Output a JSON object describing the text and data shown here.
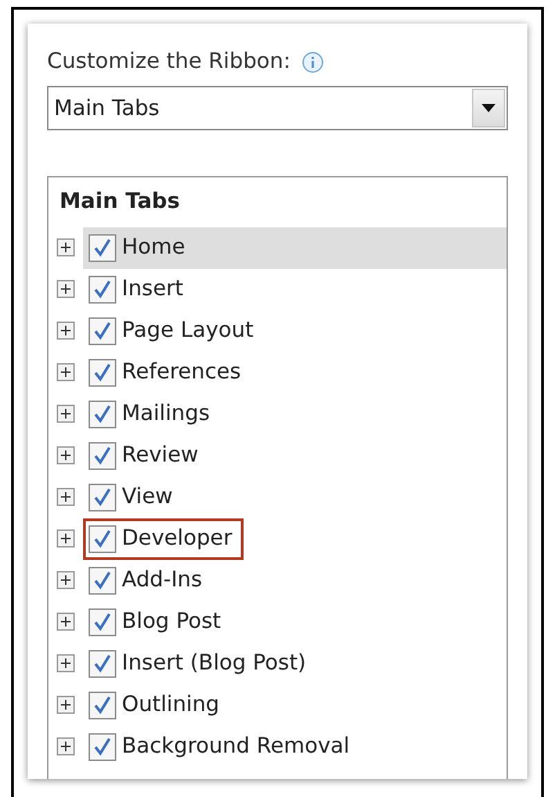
{
  "label": "Customize the Ribbon:",
  "dropdown": {
    "value": "Main Tabs"
  },
  "tree": {
    "header": "Main Tabs",
    "items": [
      {
        "label": "Home",
        "expanded": false,
        "checked": true,
        "selected": true,
        "outlined": false
      },
      {
        "label": "Insert",
        "expanded": false,
        "checked": true,
        "selected": false,
        "outlined": false
      },
      {
        "label": "Page Layout",
        "expanded": false,
        "checked": true,
        "selected": false,
        "outlined": false
      },
      {
        "label": "References",
        "expanded": false,
        "checked": true,
        "selected": false,
        "outlined": false
      },
      {
        "label": "Mailings",
        "expanded": false,
        "checked": true,
        "selected": false,
        "outlined": false
      },
      {
        "label": "Review",
        "expanded": false,
        "checked": true,
        "selected": false,
        "outlined": false
      },
      {
        "label": "View",
        "expanded": false,
        "checked": true,
        "selected": false,
        "outlined": false
      },
      {
        "label": "Developer",
        "expanded": false,
        "checked": true,
        "selected": false,
        "outlined": true
      },
      {
        "label": "Add-Ins",
        "expanded": false,
        "checked": true,
        "selected": false,
        "outlined": false
      },
      {
        "label": "Blog Post",
        "expanded": false,
        "checked": true,
        "selected": false,
        "outlined": false
      },
      {
        "label": "Insert (Blog Post)",
        "expanded": false,
        "checked": true,
        "selected": false,
        "outlined": false
      },
      {
        "label": "Outlining",
        "expanded": false,
        "checked": true,
        "selected": false,
        "outlined": false
      },
      {
        "label": "Background Removal",
        "expanded": false,
        "checked": true,
        "selected": false,
        "outlined": false
      }
    ]
  }
}
